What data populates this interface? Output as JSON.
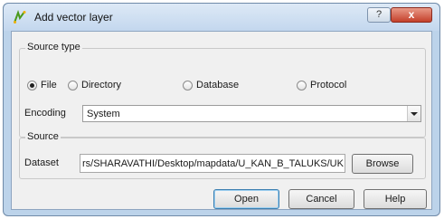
{
  "window": {
    "title": "Add vector layer",
    "help_glyph": "?",
    "close_glyph": "x",
    "icon": "vector-layer-icon"
  },
  "source_type": {
    "group_label": "Source type",
    "options": [
      {
        "label": "File",
        "selected": true
      },
      {
        "label": "Directory",
        "selected": false
      },
      {
        "label": "Database",
        "selected": false
      },
      {
        "label": "Protocol",
        "selected": false
      }
    ],
    "encoding_label": "Encoding",
    "encoding_value": "System"
  },
  "source": {
    "group_label": "Source",
    "dataset_label": "Dataset",
    "dataset_value": "rs/SHARAVATHI/Desktop/mapdata/U_KAN_B_TALUKS/UK.TAB",
    "browse_label": "Browse"
  },
  "buttons": {
    "open": "Open",
    "cancel": "Cancel",
    "help": "Help"
  },
  "colors": {
    "frame": "#bcd3ea",
    "dialog_bg": "#f0f0f0",
    "close_button": "#c4402b"
  }
}
